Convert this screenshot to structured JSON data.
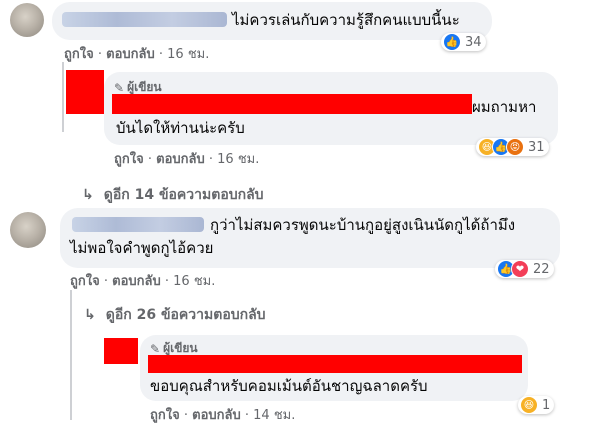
{
  "comments": [
    {
      "text": "ไม่ควรเล่นกับความรู้สึกคนแบบนี้นะ",
      "actions": {
        "like": "ถูกใจ",
        "reply": "ตอบกลับ",
        "time": "16 ชม."
      },
      "reactions": {
        "count": "34",
        "types": [
          "like"
        ]
      }
    },
    {
      "author_badge": "ผู้เขียน",
      "text_line1": "ผมถามหา",
      "text_line2": "บันไดให้ท่านน่ะครับ",
      "actions": {
        "like": "ถูกใจ",
        "reply": "ตอบกลับ",
        "time": "16 ชม."
      },
      "reactions": {
        "count": "31",
        "types": [
          "haha",
          "like",
          "angry"
        ]
      }
    },
    {
      "more_replies": "ดูอีก 14 ข้อความตอบกลับ"
    },
    {
      "text_line1": "กูว่าไม่สมควรพูดนะบ้านกูอยู่สูงเนินนัดกูได้ถ้ามึง",
      "text_line2": "ไม่พอใจคำพูดกูไอ้ควย",
      "actions": {
        "like": "ถูกใจ",
        "reply": "ตอบกลับ",
        "time": "16 ชม."
      },
      "reactions": {
        "count": "22",
        "types": [
          "like",
          "love"
        ]
      }
    },
    {
      "more_replies": "ดูอีก 26 ข้อความตอบกลับ"
    },
    {
      "author_badge": "ผู้เขียน",
      "text": "ขอบคุณสำหรับคอมเม้นต์อันชาญฉลาดครับ",
      "actions": {
        "like": "ถูกใจ",
        "reply": "ตอบกลับ",
        "time": "14 ชม."
      },
      "reactions": {
        "count": "1",
        "types": [
          "haha"
        ]
      }
    }
  ],
  "ui": {
    "separator": "·",
    "colors": {
      "redaction": "#ff0000",
      "bubble": "#f0f2f5",
      "meta": "#65676b",
      "like": "#1877f2"
    }
  }
}
